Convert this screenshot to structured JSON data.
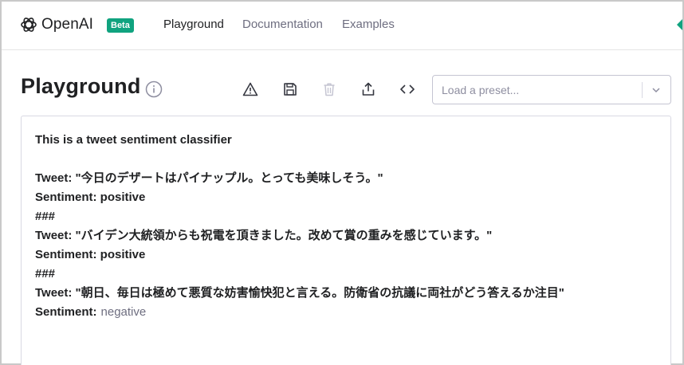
{
  "nav": {
    "brand": "OpenAI",
    "badge": "Beta",
    "links": [
      "Playground",
      "Documentation",
      "Examples"
    ],
    "active": "Playground"
  },
  "header": {
    "title": "Playground"
  },
  "toolbar": {
    "icons": [
      "warning-icon",
      "save-icon",
      "trash-icon",
      "share-icon",
      "code-icon"
    ]
  },
  "preset": {
    "placeholder": "Load a preset..."
  },
  "prompt": {
    "heading": "This is a tweet sentiment classifier",
    "lines": [
      "Tweet: \"今日のデザートはパイナップル。とっても美味しそう。\"",
      "Sentiment: positive",
      "###",
      "Tweet: \"バイデン大統領からも祝電を頂きました。改めて賞の重みを感じています。\"",
      "Sentiment: positive",
      "###",
      "Tweet: \"朝日、毎日は極めて悪質な妨害愉快犯と言える。防衛省の抗議に両社がどう答えるか注目\""
    ],
    "last_label": "Sentiment:",
    "completion": "negative"
  },
  "colors": {
    "accent": "#10a37f",
    "text": "#202123",
    "muted": "#6e6e80",
    "border": "#d9d9e3"
  }
}
